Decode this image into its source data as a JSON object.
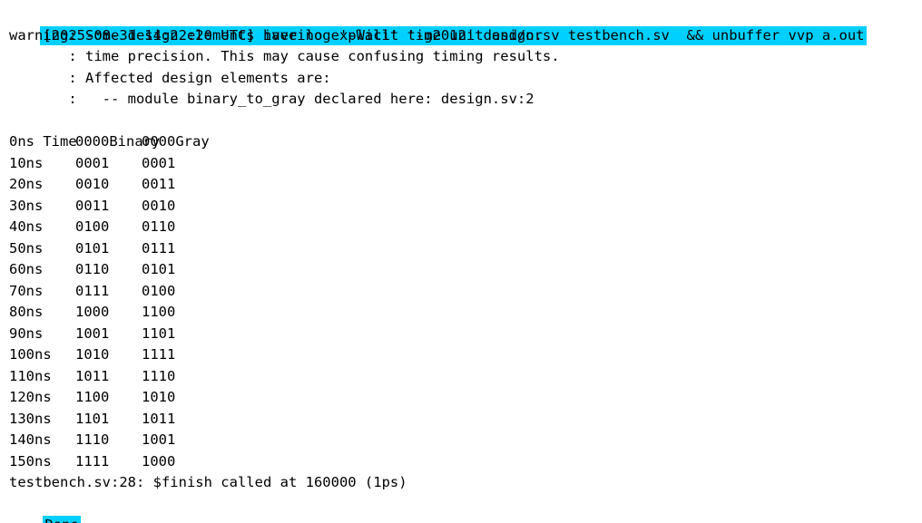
{
  "command_line": "[2025-08-31 14:22:20 UTC] iverilog '-Wall' '-g2012' design.sv testbench.sv  && unbuffer vvp a.out",
  "warning_lines": [
    "warning: Some design elements have no explicit time unit and/or",
    "       : time precision. This may cause confusing timing results.",
    "       : Affected design elements are:",
    "       :   -- module binary_to_gray declared here: design.sv:2"
  ],
  "table": {
    "headers": [
      "Time",
      "Binary",
      "Gray"
    ],
    "rows": [
      [
        "0ns",
        "0000",
        "0000"
      ],
      [
        "10ns",
        "0001",
        "0001"
      ],
      [
        "20ns",
        "0010",
        "0011"
      ],
      [
        "30ns",
        "0011",
        "0010"
      ],
      [
        "40ns",
        "0100",
        "0110"
      ],
      [
        "50ns",
        "0101",
        "0111"
      ],
      [
        "60ns",
        "0110",
        "0101"
      ],
      [
        "70ns",
        "0111",
        "0100"
      ],
      [
        "80ns",
        "1000",
        "1100"
      ],
      [
        "90ns",
        "1001",
        "1101"
      ],
      [
        "100ns",
        "1010",
        "1111"
      ],
      [
        "110ns",
        "1011",
        "1110"
      ],
      [
        "120ns",
        "1100",
        "1010"
      ],
      [
        "130ns",
        "1101",
        "1011"
      ],
      [
        "140ns",
        "1110",
        "1001"
      ],
      [
        "150ns",
        "1111",
        "1000"
      ]
    ]
  },
  "finish_line": "testbench.sv:28: $finish called at 160000 (1ps)",
  "done_label": "Done",
  "colors": {
    "highlight": "#00d0ff",
    "text": "#000000",
    "background": "#ffffff"
  }
}
